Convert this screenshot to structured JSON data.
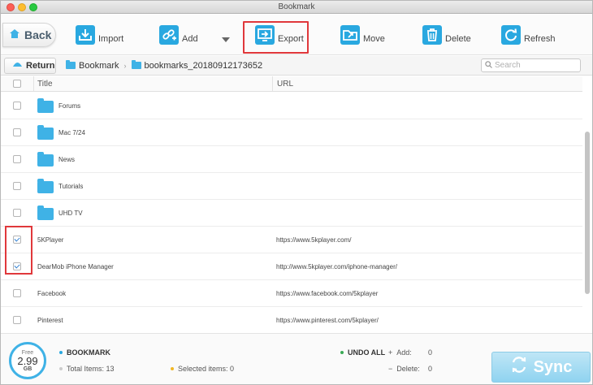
{
  "window": {
    "title": "Bookmark"
  },
  "toolbar": {
    "back_label": "Back",
    "import_label": "Import",
    "add_label": "Add",
    "export_label": "Export",
    "move_label": "Move",
    "delete_label": "Delete",
    "refresh_label": "Refresh"
  },
  "nav": {
    "return_label": "Return",
    "breadcrumb": [
      "Bookmark",
      "bookmarks_20180912173652"
    ],
    "search_placeholder": "Search"
  },
  "table": {
    "columns": [
      "Title",
      "URL"
    ],
    "rows": [
      {
        "title": "Forums",
        "url": "",
        "folder": true,
        "checked": false
      },
      {
        "title": "Mac 7/24",
        "url": "",
        "folder": true,
        "checked": false
      },
      {
        "title": "News",
        "url": "",
        "folder": true,
        "checked": false
      },
      {
        "title": "Tutorials",
        "url": "",
        "folder": true,
        "checked": false
      },
      {
        "title": "UHD TV",
        "url": "",
        "folder": true,
        "checked": false
      },
      {
        "title": "5KPlayer",
        "url": "https://www.5kplayer.com/",
        "folder": false,
        "checked": true
      },
      {
        "title": "DearMob iPhone Manager",
        "url": "http://www.5kplayer.com/iphone-manager/",
        "folder": false,
        "checked": true
      },
      {
        "title": "Facebook",
        "url": "https://www.facebook.com/5kplayer",
        "folder": false,
        "checked": false
      },
      {
        "title": "Pinterest",
        "url": "https://www.pinterest.com/5kplayer/",
        "folder": false,
        "checked": false
      }
    ]
  },
  "footer": {
    "free_label": "Free",
    "free_value": "2.99",
    "free_unit": "GB",
    "section_label": "BOOKMARK",
    "total_items_label": "Total Items: 13",
    "selected_items_label": "Selected items: 0",
    "undo_label": "UNDO ALL",
    "add_label": "Add:",
    "add_value": "0",
    "delete_label": "Delete:",
    "delete_value": "0",
    "sync_label": "Sync"
  },
  "colors": {
    "accent": "#29a8e0",
    "highlight": "#e0383b",
    "undo_green": "#3aaa55",
    "selected_yellow": "#f2b724"
  }
}
